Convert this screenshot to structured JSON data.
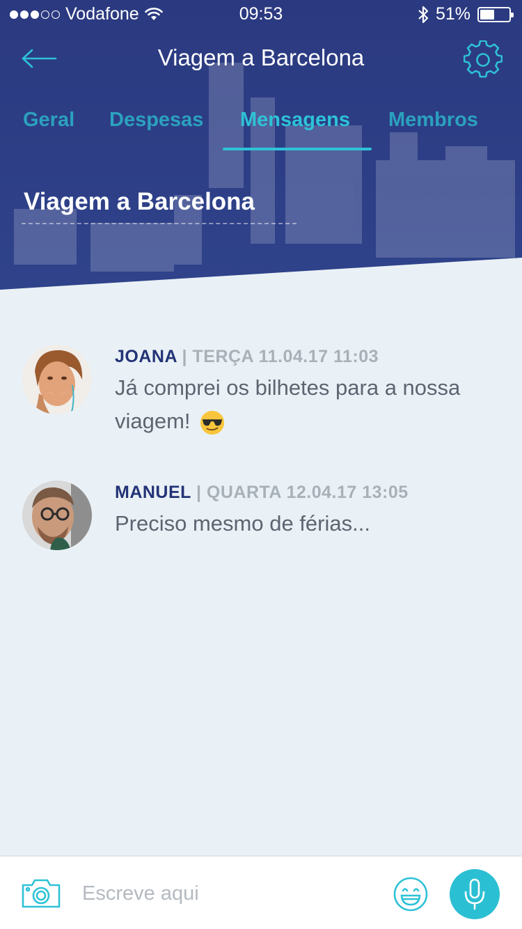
{
  "statusbar": {
    "carrier": "Vodafone",
    "time": "09:53",
    "battery": "51%",
    "battery_level": 0.51
  },
  "nav": {
    "title": "Viagem a Barcelona",
    "back_icon": "arrow-left-icon",
    "settings_icon": "gear-icon"
  },
  "tabs": [
    {
      "label": "Geral",
      "active": false
    },
    {
      "label": "Despesas",
      "active": false
    },
    {
      "label": "Mensagens",
      "active": true
    },
    {
      "label": "Membros",
      "active": false
    }
  ],
  "group": {
    "title": "Viagem a Barcelona"
  },
  "messages": [
    {
      "author": "JOANA",
      "separator": "|",
      "timestamp": "TERÇA 11.04.17 11:03",
      "text": "Já comprei os bilhetes para a nossa viagem!",
      "emoji": "sunglasses-emoji"
    },
    {
      "author": "MANUEL",
      "separator": "|",
      "timestamp": "QUARTA 12.04.17 13:05",
      "text": "Preciso mesmo de férias..."
    }
  ],
  "composer": {
    "placeholder": "Escreve aqui",
    "camera_icon": "camera-icon",
    "emoji_icon": "smiley-icon",
    "mic_icon": "microphone-icon"
  },
  "colors": {
    "header_bg": "#2d3e86",
    "accent": "#2ec2d6",
    "author": "#233376",
    "background": "#eaf1f6"
  }
}
